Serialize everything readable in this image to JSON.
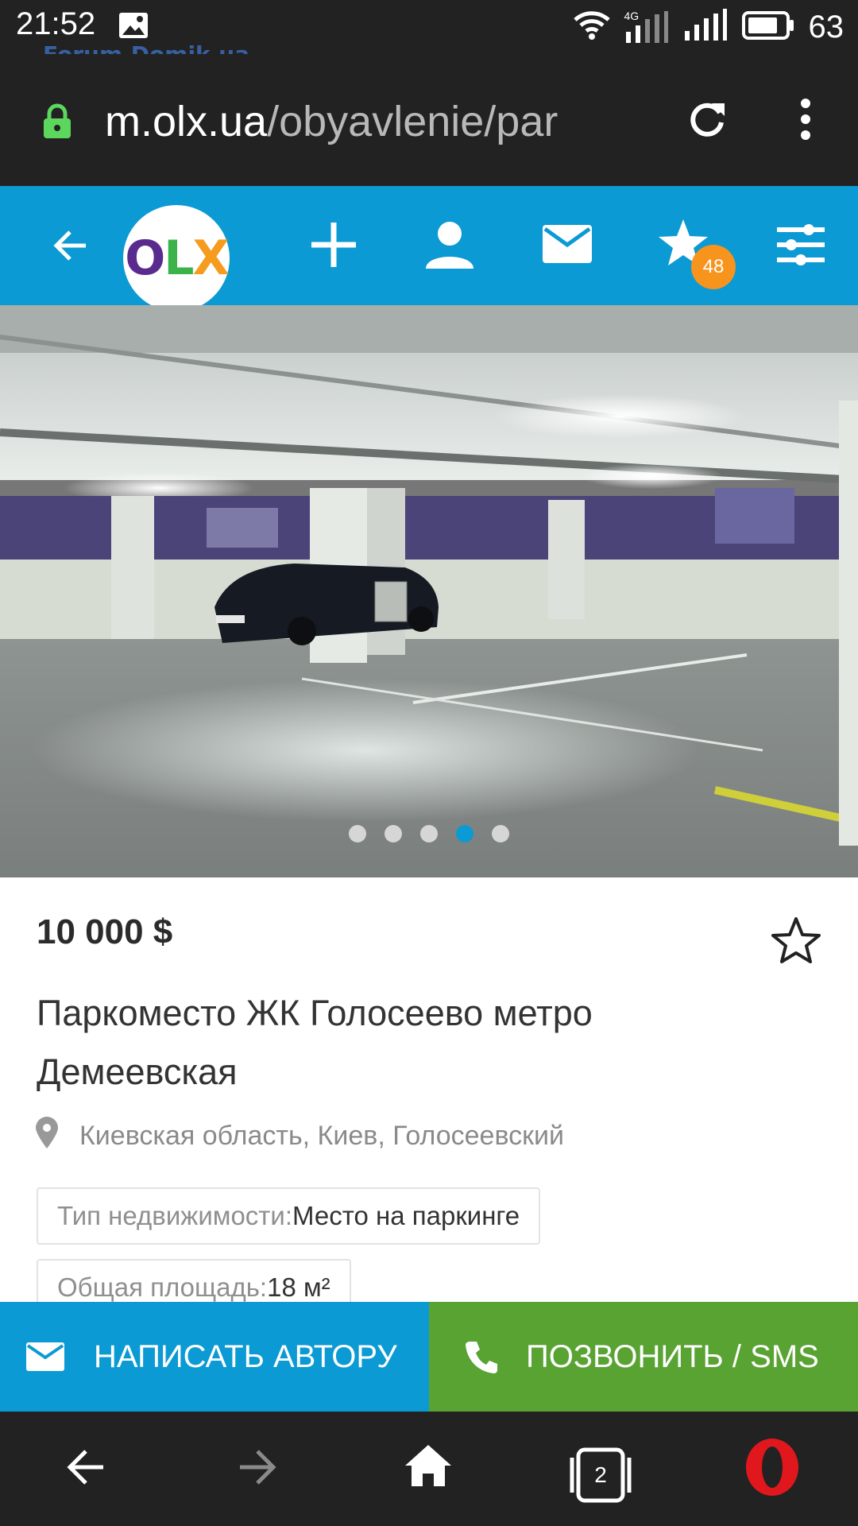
{
  "status_bar": {
    "time": "21:52",
    "battery": "63",
    "network": "4G",
    "icons": [
      "gallery-icon",
      "wifi-icon",
      "mobile-data-icon",
      "signal-icon",
      "battery-icon"
    ]
  },
  "watermark": "Forum.Domik.ua",
  "browser": {
    "url_domain": "m.olx.ua",
    "url_path": "/obyavlenie/par",
    "icons": [
      "lock-icon",
      "reload-icon",
      "more-vert-icon"
    ]
  },
  "olx_header": {
    "logo": {
      "o": "O",
      "l": "L",
      "x": "X"
    },
    "favorites_count": "48",
    "icons": [
      "back-arrow-icon",
      "add-icon",
      "account-icon",
      "mail-icon",
      "star-icon",
      "filter-icon"
    ]
  },
  "gallery": {
    "photo": "parking-photo",
    "total": 5,
    "active_index": 3
  },
  "listing": {
    "price": "10 000 $",
    "title": "Паркоместо ЖК Голосеево метро Демеевская",
    "location": "Киевская область, Киев, Голосеевский",
    "params": [
      {
        "key": "Тип недвижимости: ",
        "value": "Место на паркинге"
      },
      {
        "key": "Общая площадь: ",
        "value": "18 м²"
      }
    ]
  },
  "actions": {
    "write": "НАПИСАТЬ АВТОРУ",
    "call": "ПОЗВОНИТЬ / SMS"
  },
  "bottom_nav": {
    "tabs_count": "2",
    "icons": [
      "nav-back-icon",
      "nav-forward-icon",
      "home-icon",
      "tabs-icon",
      "opera-icon"
    ]
  },
  "colors": {
    "olx_blue": "#0b9ad3",
    "call_green": "#59a333",
    "badge_orange": "#f7941d",
    "browser_dark": "#222222"
  }
}
